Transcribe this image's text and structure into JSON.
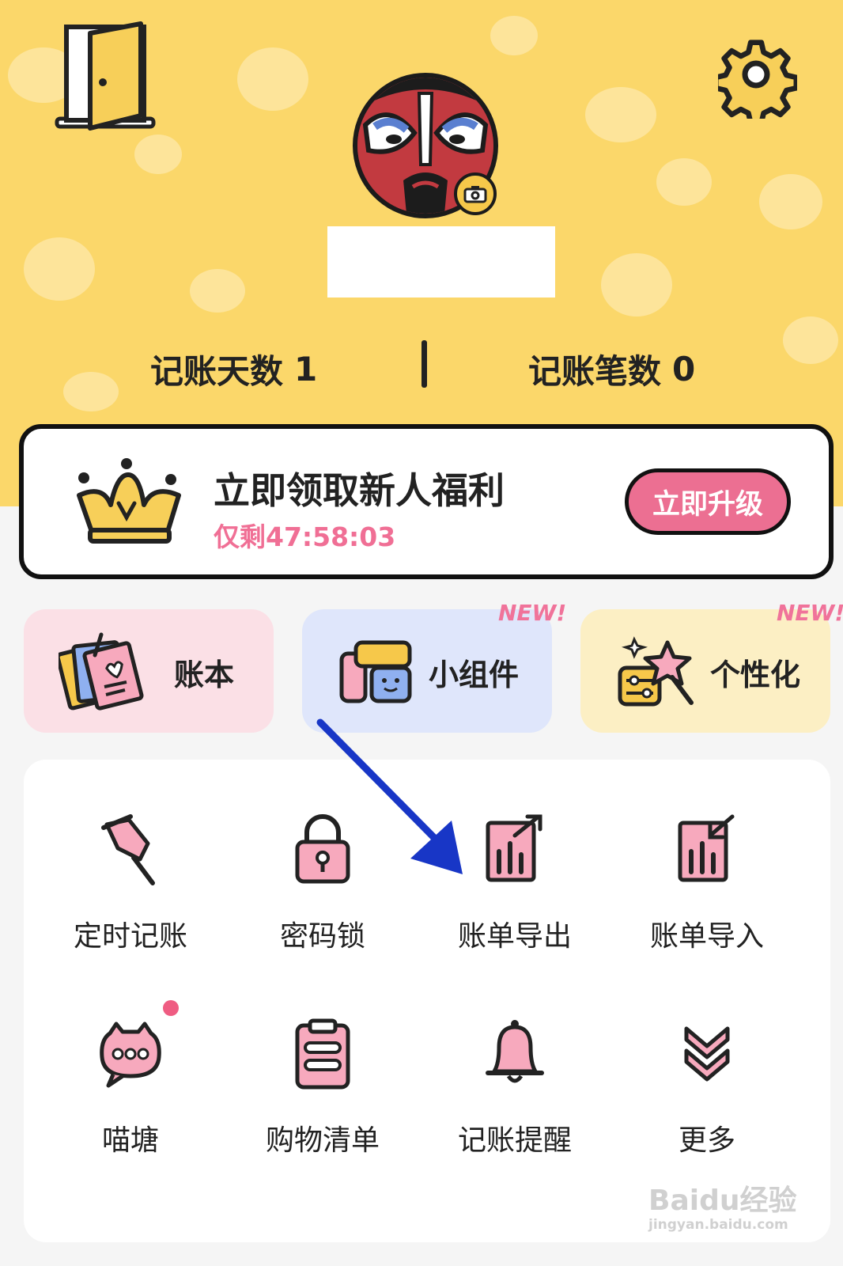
{
  "colors": {
    "header_bg": "#fbd76a",
    "accent_pink": "#ec6f92",
    "timer_pink": "#f06f95",
    "card_pink": "#fbe0e6",
    "card_blue": "#dfe6fb",
    "card_yellow": "#fcefc4",
    "arrow_blue": "#1836c6"
  },
  "header": {
    "exit_icon": "door-icon",
    "settings_icon": "gear-icon",
    "avatar_icon": "opera-mask-avatar",
    "camera_icon": "camera-icon"
  },
  "stats": {
    "days_label": "记账天数",
    "days_value": "1",
    "count_label": "记账笔数",
    "count_value": "0"
  },
  "promo": {
    "icon": "crown-icon",
    "title": "立即领取新人福利",
    "timer": "仅剩47:58:03",
    "button": "立即升级"
  },
  "features": [
    {
      "label": "账本",
      "icon": "ledger-book-icon",
      "new": ""
    },
    {
      "label": "小组件",
      "icon": "widget-icon",
      "new": "NEW!"
    },
    {
      "label": "个性化",
      "icon": "personalize-star-icon",
      "new": "NEW!"
    }
  ],
  "grid": [
    {
      "label": "定时记账",
      "icon": "pushpin-icon"
    },
    {
      "label": "密码锁",
      "icon": "padlock-icon"
    },
    {
      "label": "账单导出",
      "icon": "export-chart-icon"
    },
    {
      "label": "账单导入",
      "icon": "import-chart-icon"
    },
    {
      "label": "喵塘",
      "icon": "cat-chat-icon"
    },
    {
      "label": "购物清单",
      "icon": "clipboard-list-icon"
    },
    {
      "label": "记账提醒",
      "icon": "bell-icon"
    },
    {
      "label": "更多",
      "icon": "double-chevron-down-icon"
    }
  ],
  "watermark": {
    "logo": "Baidu经验",
    "url": "jingyan.baidu.com"
  }
}
